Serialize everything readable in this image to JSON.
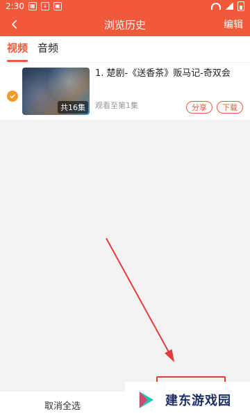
{
  "status_bar": {
    "time": "2:30",
    "icons": [
      "news-icon",
      "download-icon",
      "image-icon",
      "wifi-icon",
      "signal-icon",
      "battery-icon"
    ]
  },
  "header": {
    "title": "浏览历史",
    "edit_label": "编辑",
    "back_icon": "chevron-left-icon"
  },
  "tabs": [
    {
      "label": "视频",
      "active": true
    },
    {
      "label": "音频",
      "active": false
    }
  ],
  "history_items": [
    {
      "title": "1. 楚剧-《送香茶》贩马记-奇双会",
      "episodes_badge": "共16集",
      "progress_text": "观看至第1集",
      "share_label": "分享",
      "download_label": "下载",
      "selected": true
    }
  ],
  "bottom_bar": {
    "cancel_select_label": "取消全选"
  },
  "watermark": {
    "text": "建东游戏园"
  },
  "colors": {
    "brand": "#f05a3a",
    "check": "#f39a2a",
    "annotation": "#e43a3a",
    "watermark_text": "#1c2f63"
  }
}
